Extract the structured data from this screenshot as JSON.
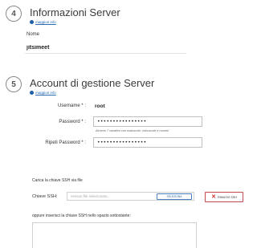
{
  "section4": {
    "number": "4",
    "title": "Informazioni Server",
    "info_link": "maggiori info",
    "name_label": "Nome",
    "name_value": "jitsimeet"
  },
  "section5": {
    "number": "5",
    "title": "Account di gestione Server",
    "info_link": "maggiori info",
    "username_label": "Username * :",
    "username_value": "root",
    "password_label": "Password * :",
    "password_value": "••••••••••••••••",
    "password_hint": "Almeno 7 caratteri con maiuscole, minuscole e numeri",
    "repeat_password_label": "Ripeti Password * :",
    "repeat_password_value": "••••••••••••••••"
  },
  "ssh": {
    "upload_label": "Carica la chiave SSH via file",
    "key_label": "Chiave SSH:",
    "file_placeholder": "nessun file selezionato...",
    "select_button": "SELEZIONA",
    "remove_button": "RIMUOVI SSH",
    "paste_label": "oppure inserisci la chiave SSH nello spazio sottostante:",
    "textarea_value": ""
  },
  "colors": {
    "accent": "#1f5fa8",
    "danger": "#d12f2f"
  }
}
